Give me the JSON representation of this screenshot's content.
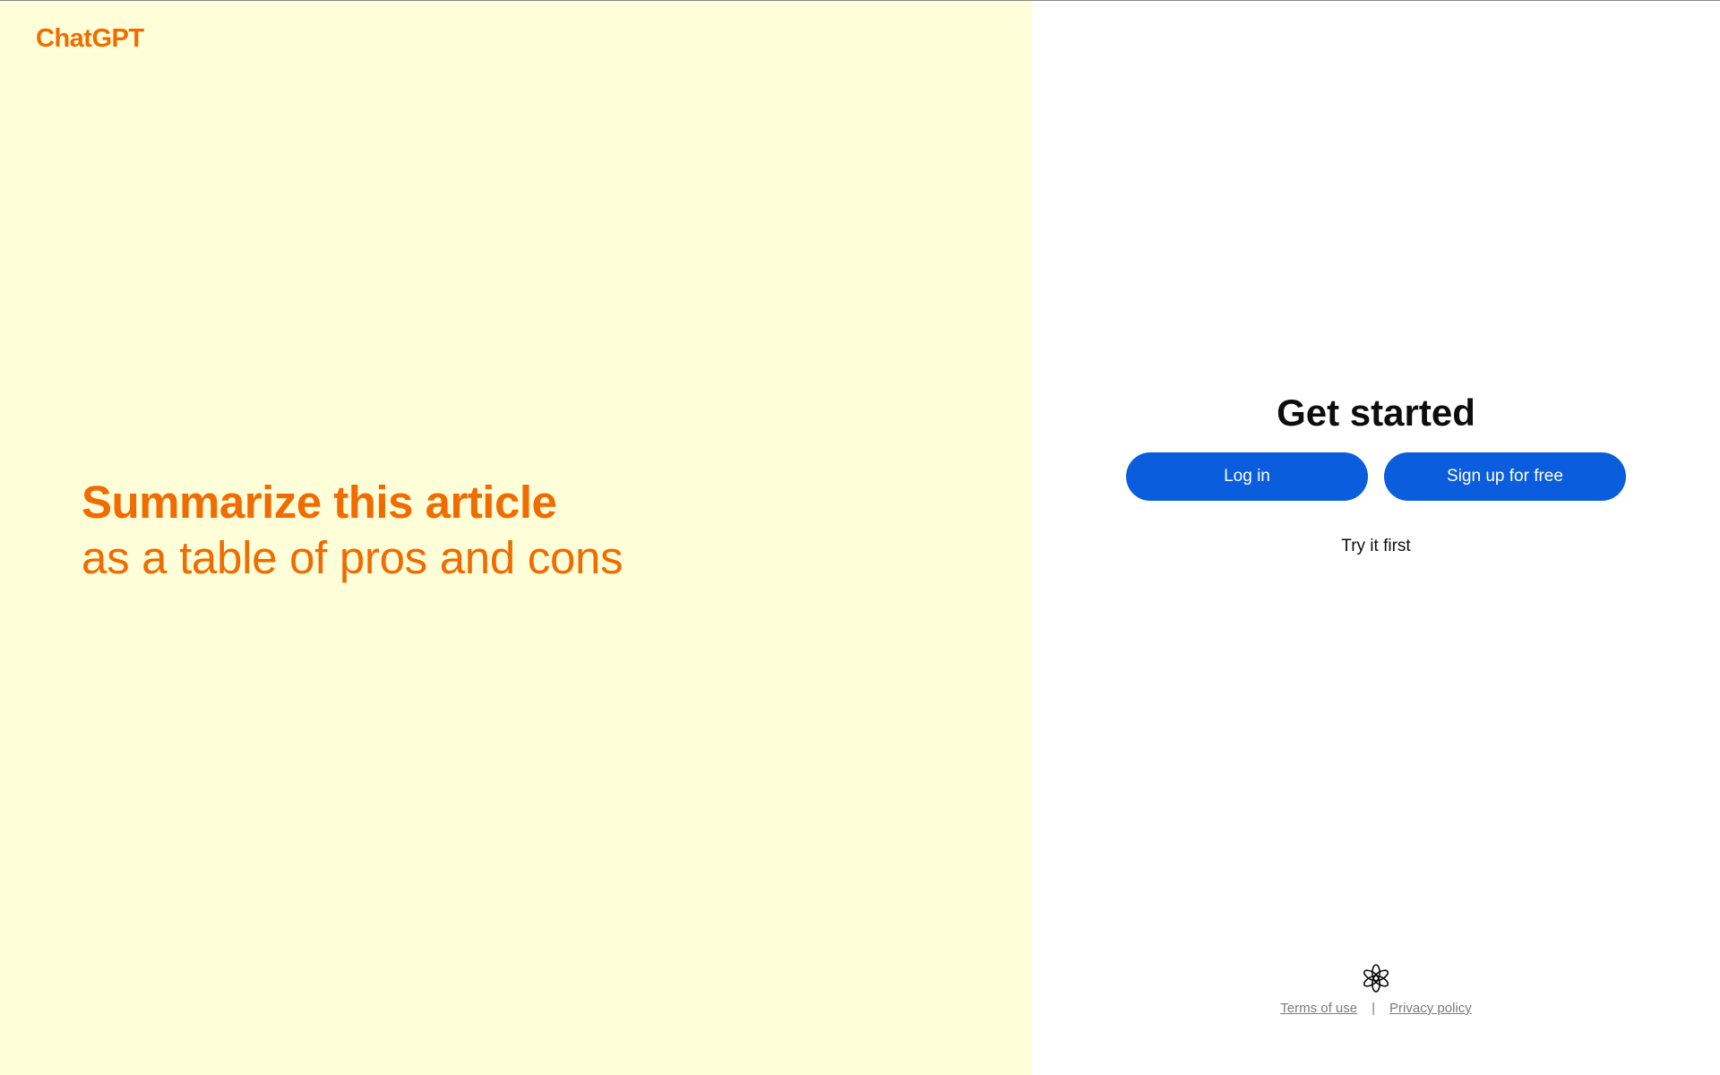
{
  "brand": {
    "name": "ChatGPT"
  },
  "hero": {
    "line1": "Summarize this article",
    "line2": "as a table of pros and cons"
  },
  "auth": {
    "title": "Get started",
    "login_label": "Log in",
    "signup_label": "Sign up for free",
    "try_label": "Try it first"
  },
  "footer": {
    "logo_icon": "openai-logo-icon",
    "terms_label": "Terms of use",
    "separator": "|",
    "privacy_label": "Privacy policy"
  },
  "colors": {
    "accent_orange": "#f06b00",
    "left_background": "#fefed8",
    "button_blue": "#0a5ddc"
  }
}
